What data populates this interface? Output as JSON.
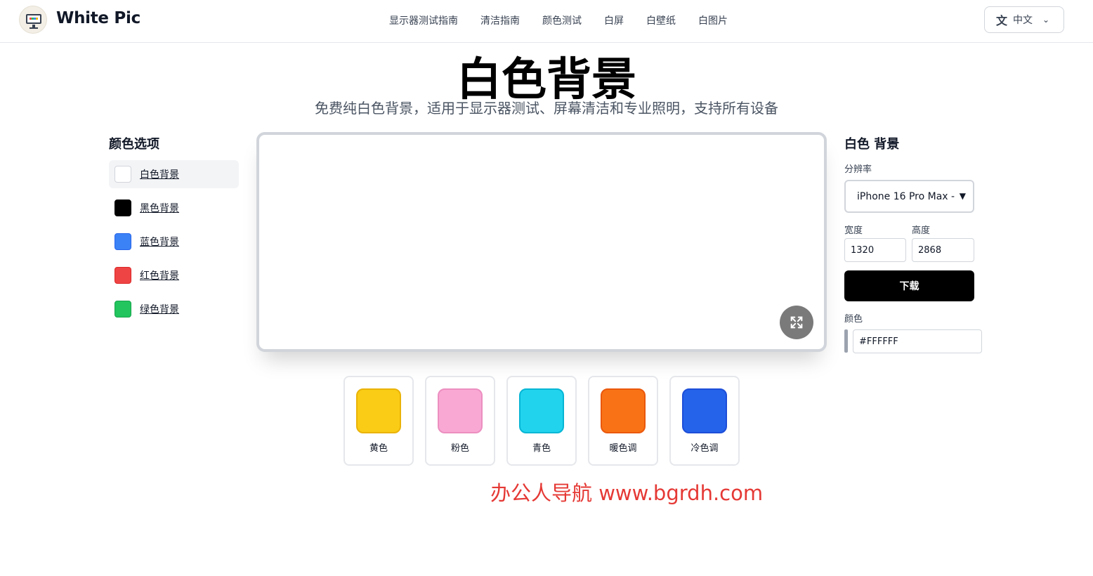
{
  "header": {
    "brand": "White Pic",
    "nav": [
      "显示器测试指南",
      "清洁指南",
      "颜色测试",
      "白屏",
      "白壁纸",
      "白图片"
    ],
    "language": "中文",
    "language_icon": "translate-icon"
  },
  "hero": {
    "title": "白色背景",
    "subtitle": "免费纯白色背景，适用于显示器测试、屏幕清洁和专业照明，支持所有设备"
  },
  "color_options": {
    "title": "颜色选项",
    "items": [
      {
        "label": "白色背景",
        "color": "#FFFFFF",
        "active": true
      },
      {
        "label": "黑色背景",
        "color": "#000000",
        "active": false
      },
      {
        "label": "蓝色背景",
        "color": "#3B82F6",
        "active": false
      },
      {
        "label": "红色背景",
        "color": "#EF4444",
        "active": false
      },
      {
        "label": "绿色背景",
        "color": "#22C55E",
        "active": false
      }
    ]
  },
  "preview": {
    "background": "#FFFFFF",
    "fullscreen_icon": "fullscreen-icon"
  },
  "settings": {
    "title": "白色 背景",
    "resolution_label": "分辨率",
    "resolution_value": "iPhone 16 Pro Max -",
    "width_label": "宽度",
    "width_value": "1320",
    "height_label": "高度",
    "height_value": "2868",
    "download_label": "下载",
    "color_label": "颜色",
    "color_value": "#FFFFFF"
  },
  "swatches": [
    {
      "label": "黄色",
      "color": "#FACC15"
    },
    {
      "label": "粉色",
      "color": "#F9A8D4"
    },
    {
      "label": "青色",
      "color": "#22D3EE"
    },
    {
      "label": "暖色调",
      "color": "#F97316"
    },
    {
      "label": "冷色调",
      "color": "#2563EB"
    }
  ],
  "watermark": "办公人导航  www.bgrdh.com"
}
